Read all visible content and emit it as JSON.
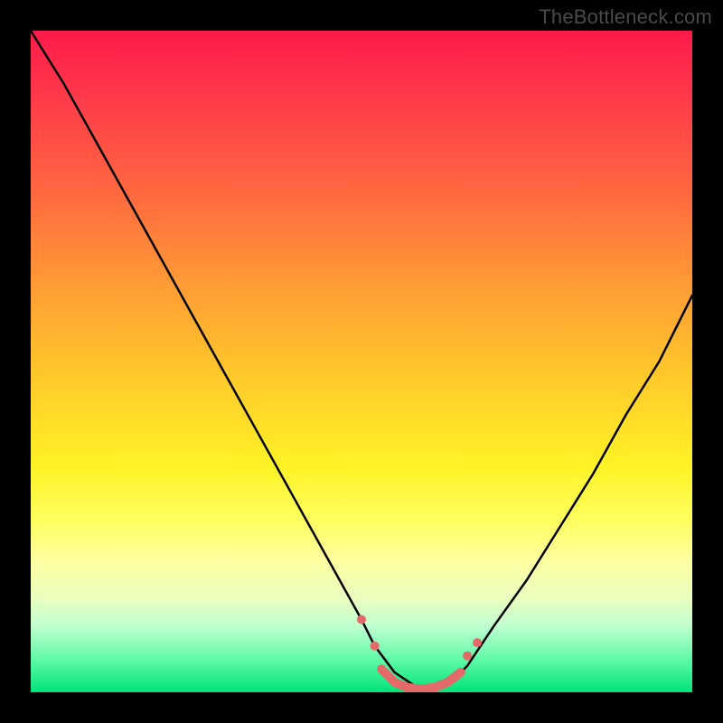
{
  "watermark": "TheBottleneck.com",
  "chart_data": {
    "type": "line",
    "title": "",
    "xlabel": "",
    "ylabel": "",
    "xlim": [
      0,
      100
    ],
    "ylim": [
      0,
      100
    ],
    "legend": false,
    "grid": false,
    "background_gradient": {
      "orientation": "vertical",
      "stops": [
        {
          "pos": 0.0,
          "color": "#ff1a4b"
        },
        {
          "pos": 0.25,
          "color": "#ff6a3f"
        },
        {
          "pos": 0.5,
          "color": "#ffc82a"
        },
        {
          "pos": 0.7,
          "color": "#ffff50"
        },
        {
          "pos": 0.85,
          "color": "#d9ffc0"
        },
        {
          "pos": 1.0,
          "color": "#00e47a"
        }
      ]
    },
    "series": [
      {
        "name": "bottleneck-curve",
        "color": "#000000",
        "x": [
          0,
          5,
          10,
          15,
          20,
          25,
          30,
          35,
          40,
          45,
          50,
          52,
          55,
          58,
          60,
          62,
          64,
          66,
          70,
          75,
          80,
          85,
          90,
          95,
          100
        ],
        "y": [
          100,
          92,
          83,
          74,
          65,
          56,
          47,
          38,
          29,
          20,
          11,
          7,
          3,
          1,
          0.5,
          1,
          2,
          4,
          10,
          17,
          25,
          33,
          42,
          50,
          60
        ]
      }
    ],
    "markers": [
      {
        "name": "left-dot-1",
        "x": 50.0,
        "y": 11.0,
        "r": 5,
        "color": "#e46a6a"
      },
      {
        "name": "left-dot-2",
        "x": 52.0,
        "y": 7.0,
        "r": 5,
        "color": "#e46a6a"
      },
      {
        "name": "right-dot-1",
        "x": 66.0,
        "y": 5.5,
        "r": 5,
        "color": "#e46a6a"
      },
      {
        "name": "right-dot-2",
        "x": 67.5,
        "y": 7.5,
        "r": 5,
        "color": "#e46a6a"
      }
    ],
    "bottom_band": {
      "name": "valley-band",
      "color": "#e46a6a",
      "x": [
        53,
        55,
        57,
        59,
        61,
        63,
        65
      ],
      "y": [
        3.5,
        1.5,
        0.7,
        0.5,
        0.7,
        1.5,
        3.0
      ],
      "width": 10
    }
  }
}
